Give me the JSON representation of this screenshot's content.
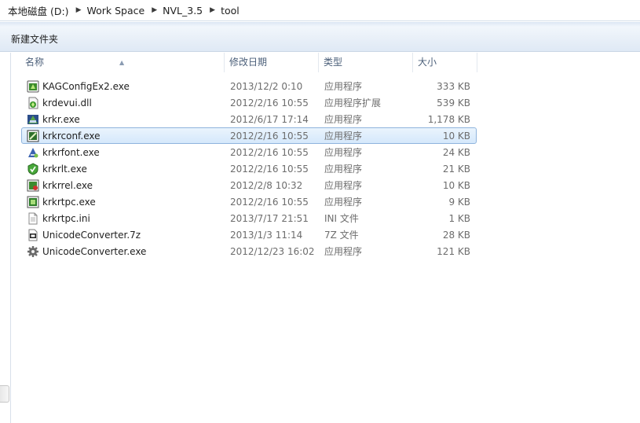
{
  "breadcrumb": [
    "本地磁盘 (D:)",
    "Work Space",
    "NVL_3.5",
    "tool"
  ],
  "toolbar": {
    "new_folder_label": "新建文件夹"
  },
  "columns": {
    "name": "名称",
    "date": "修改日期",
    "type": "类型",
    "size": "大小"
  },
  "files": [
    {
      "name": "KAGConfigEx2.exe",
      "date": "2013/12/2 0:10",
      "type": "应用程序",
      "size": "333 KB",
      "icon": "kag-config-icon"
    },
    {
      "name": "krdevui.dll",
      "date": "2012/2/16 10:55",
      "type": "应用程序扩展",
      "size": "539 KB",
      "icon": "dll-icon"
    },
    {
      "name": "krkr.exe",
      "date": "2012/6/17 17:14",
      "type": "应用程序",
      "size": "1,178 KB",
      "icon": "krkr-icon"
    },
    {
      "name": "krkrconf.exe",
      "date": "2012/2/16 10:55",
      "type": "应用程序",
      "size": "10 KB",
      "icon": "krkrconf-icon",
      "selected": true
    },
    {
      "name": "krkrfont.exe",
      "date": "2012/2/16 10:55",
      "type": "应用程序",
      "size": "24 KB",
      "icon": "krkrfont-icon"
    },
    {
      "name": "krkrlt.exe",
      "date": "2012/2/16 10:55",
      "type": "应用程序",
      "size": "21 KB",
      "icon": "krkrlt-icon"
    },
    {
      "name": "krkrrel.exe",
      "date": "2012/2/8 10:32",
      "type": "应用程序",
      "size": "10 KB",
      "icon": "krkrrel-icon"
    },
    {
      "name": "krkrtpc.exe",
      "date": "2012/2/16 10:55",
      "type": "应用程序",
      "size": "9 KB",
      "icon": "krkrtpc-icon"
    },
    {
      "name": "krkrtpc.ini",
      "date": "2013/7/17 21:51",
      "type": "INI 文件",
      "size": "1 KB",
      "icon": "ini-file-icon"
    },
    {
      "name": "UnicodeConverter.7z",
      "date": "2013/1/3 11:14",
      "type": "7Z 文件",
      "size": "28 KB",
      "icon": "archive-7z-icon"
    },
    {
      "name": "UnicodeConverter.exe",
      "date": "2012/12/23 16:02",
      "type": "应用程序",
      "size": "121 KB",
      "icon": "gear-icon"
    }
  ]
}
